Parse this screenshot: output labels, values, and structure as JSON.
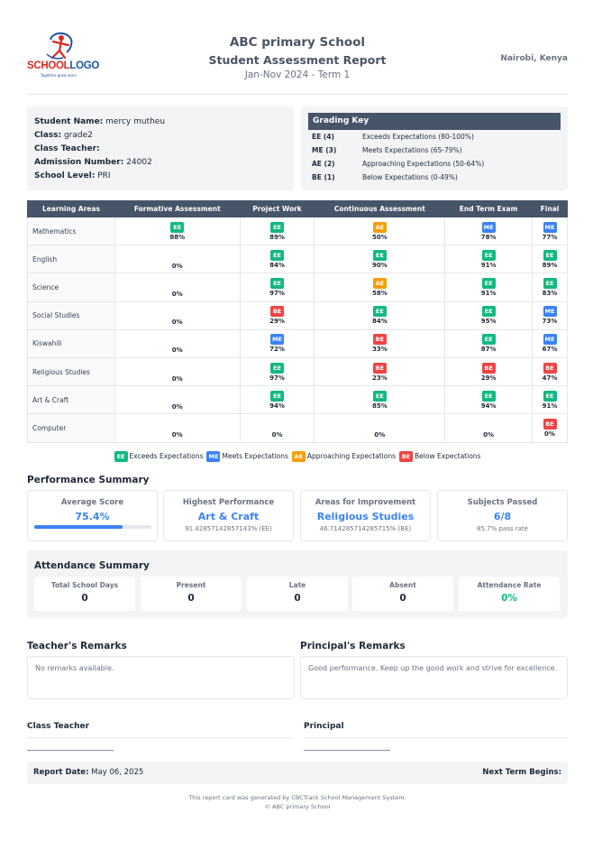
{
  "header": {
    "logo_text_red": "SCHOOL",
    "logo_text_blue": "LOGO",
    "logo_tagline": "Together grow learn",
    "school_name": "ABC primary School",
    "report_title": "Student Assessment Report",
    "period": "Jan-Nov 2024 - Term 1",
    "location": "Nairobi, Kenya"
  },
  "student": {
    "name_label": "Student Name:",
    "name": "mercy mutheu",
    "class_label": "Class:",
    "class": "grade2",
    "teacher_label": "Class Teacher:",
    "teacher": "",
    "admission_label": "Admission Number:",
    "admission": "24002",
    "level_label": "School Level:",
    "level": "PRI"
  },
  "grading_key": {
    "title": "Grading Key",
    "rows": [
      {
        "code": "EE (4)",
        "desc": "Exceeds Expectations (80-100%)"
      },
      {
        "code": "ME (3)",
        "desc": "Meets Expectations (65-79%)"
      },
      {
        "code": "AE (2)",
        "desc": "Approaching Expectations (50-64%)"
      },
      {
        "code": "BE (1)",
        "desc": "Below Expectations (0-49%)"
      }
    ]
  },
  "table": {
    "headers": [
      "Learning Areas",
      "Formative Assessment",
      "Project Work",
      "Continuous Assessment",
      "End Term Exam",
      "Final"
    ],
    "rows": [
      {
        "subject": "Mathematics",
        "cells": [
          {
            "g": "EE",
            "p": "88%"
          },
          {
            "g": "EE",
            "p": "89%"
          },
          {
            "g": "AE",
            "p": "50%"
          },
          {
            "g": "ME",
            "p": "78%"
          },
          {
            "g": "ME",
            "p": "77%"
          }
        ]
      },
      {
        "subject": "English",
        "cells": [
          {
            "g": "",
            "p": "0%"
          },
          {
            "g": "EE",
            "p": "84%"
          },
          {
            "g": "EE",
            "p": "90%"
          },
          {
            "g": "EE",
            "p": "91%"
          },
          {
            "g": "EE",
            "p": "89%"
          }
        ]
      },
      {
        "subject": "Science",
        "cells": [
          {
            "g": "",
            "p": "0%"
          },
          {
            "g": "EE",
            "p": "97%"
          },
          {
            "g": "AE",
            "p": "58%"
          },
          {
            "g": "EE",
            "p": "91%"
          },
          {
            "g": "EE",
            "p": "83%"
          }
        ]
      },
      {
        "subject": "Social Studies",
        "cells": [
          {
            "g": "",
            "p": "0%"
          },
          {
            "g": "BE",
            "p": "29%"
          },
          {
            "g": "EE",
            "p": "84%"
          },
          {
            "g": "EE",
            "p": "95%"
          },
          {
            "g": "ME",
            "p": "73%"
          }
        ]
      },
      {
        "subject": "Kiswahili",
        "cells": [
          {
            "g": "",
            "p": "0%"
          },
          {
            "g": "ME",
            "p": "72%"
          },
          {
            "g": "BE",
            "p": "33%"
          },
          {
            "g": "EE",
            "p": "87%"
          },
          {
            "g": "ME",
            "p": "67%"
          }
        ]
      },
      {
        "subject": "Religious Studies",
        "cells": [
          {
            "g": "",
            "p": "0%"
          },
          {
            "g": "EE",
            "p": "97%"
          },
          {
            "g": "BE",
            "p": "23%"
          },
          {
            "g": "BE",
            "p": "29%"
          },
          {
            "g": "BE",
            "p": "47%"
          }
        ]
      },
      {
        "subject": "Art & Craft",
        "cells": [
          {
            "g": "",
            "p": "0%"
          },
          {
            "g": "EE",
            "p": "94%"
          },
          {
            "g": "EE",
            "p": "85%"
          },
          {
            "g": "EE",
            "p": "94%"
          },
          {
            "g": "EE",
            "p": "91%"
          }
        ]
      },
      {
        "subject": "Computer",
        "cells": [
          {
            "g": "",
            "p": "0%"
          },
          {
            "g": "",
            "p": "0%"
          },
          {
            "g": "",
            "p": "0%"
          },
          {
            "g": "",
            "p": "0%"
          },
          {
            "g": "BE",
            "p": "0%"
          }
        ]
      }
    ]
  },
  "legend": [
    {
      "code": "EE",
      "label": "Exceeds Expectations"
    },
    {
      "code": "ME",
      "label": "Meets Expectations"
    },
    {
      "code": "AE",
      "label": "Approaching Expectations"
    },
    {
      "code": "BE",
      "label": "Below Expectations"
    }
  ],
  "performance": {
    "title": "Performance Summary",
    "average": {
      "title": "Average Score",
      "value": "75.4%",
      "fraction": 0.754
    },
    "highest": {
      "title": "Highest Performance",
      "value": "Art & Craft",
      "sub": "91.42857142857143% (EE)"
    },
    "improvement": {
      "title": "Areas for Improvement",
      "value": "Religious Studies",
      "sub": "46.714285714285715% (BE)"
    },
    "passed": {
      "title": "Subjects Passed",
      "value": "6/8",
      "sub": "85.7% pass rate"
    }
  },
  "attendance": {
    "title": "Attendance Summary",
    "items": [
      {
        "label": "Total School Days",
        "value": "0"
      },
      {
        "label": "Present",
        "value": "0"
      },
      {
        "label": "Late",
        "value": "0"
      },
      {
        "label": "Absent",
        "value": "0"
      },
      {
        "label": "Attendance Rate",
        "value": "0%"
      }
    ]
  },
  "remarks": {
    "teacher_title": "Teacher's Remarks",
    "teacher_text": "No remarks available.",
    "principal_title": "Principal's Remarks",
    "principal_text": "Good performance. Keep up the good work and strive for excellence."
  },
  "signatures": {
    "class_teacher": "Class Teacher",
    "principal": "Principal",
    "line": "________________________"
  },
  "footer": {
    "report_date_label": "Report Date:",
    "report_date": "May 06, 2025",
    "next_term_label": "Next Term Begins:",
    "generated": "This report card was generated by CBCTrack School Management System.",
    "copyright": "© ABC primary School"
  },
  "colors": {
    "EE": "#10b981",
    "ME": "#3b82f6",
    "AE": "#f59e0b",
    "BE": "#ef4444",
    "header": "#475569"
  }
}
